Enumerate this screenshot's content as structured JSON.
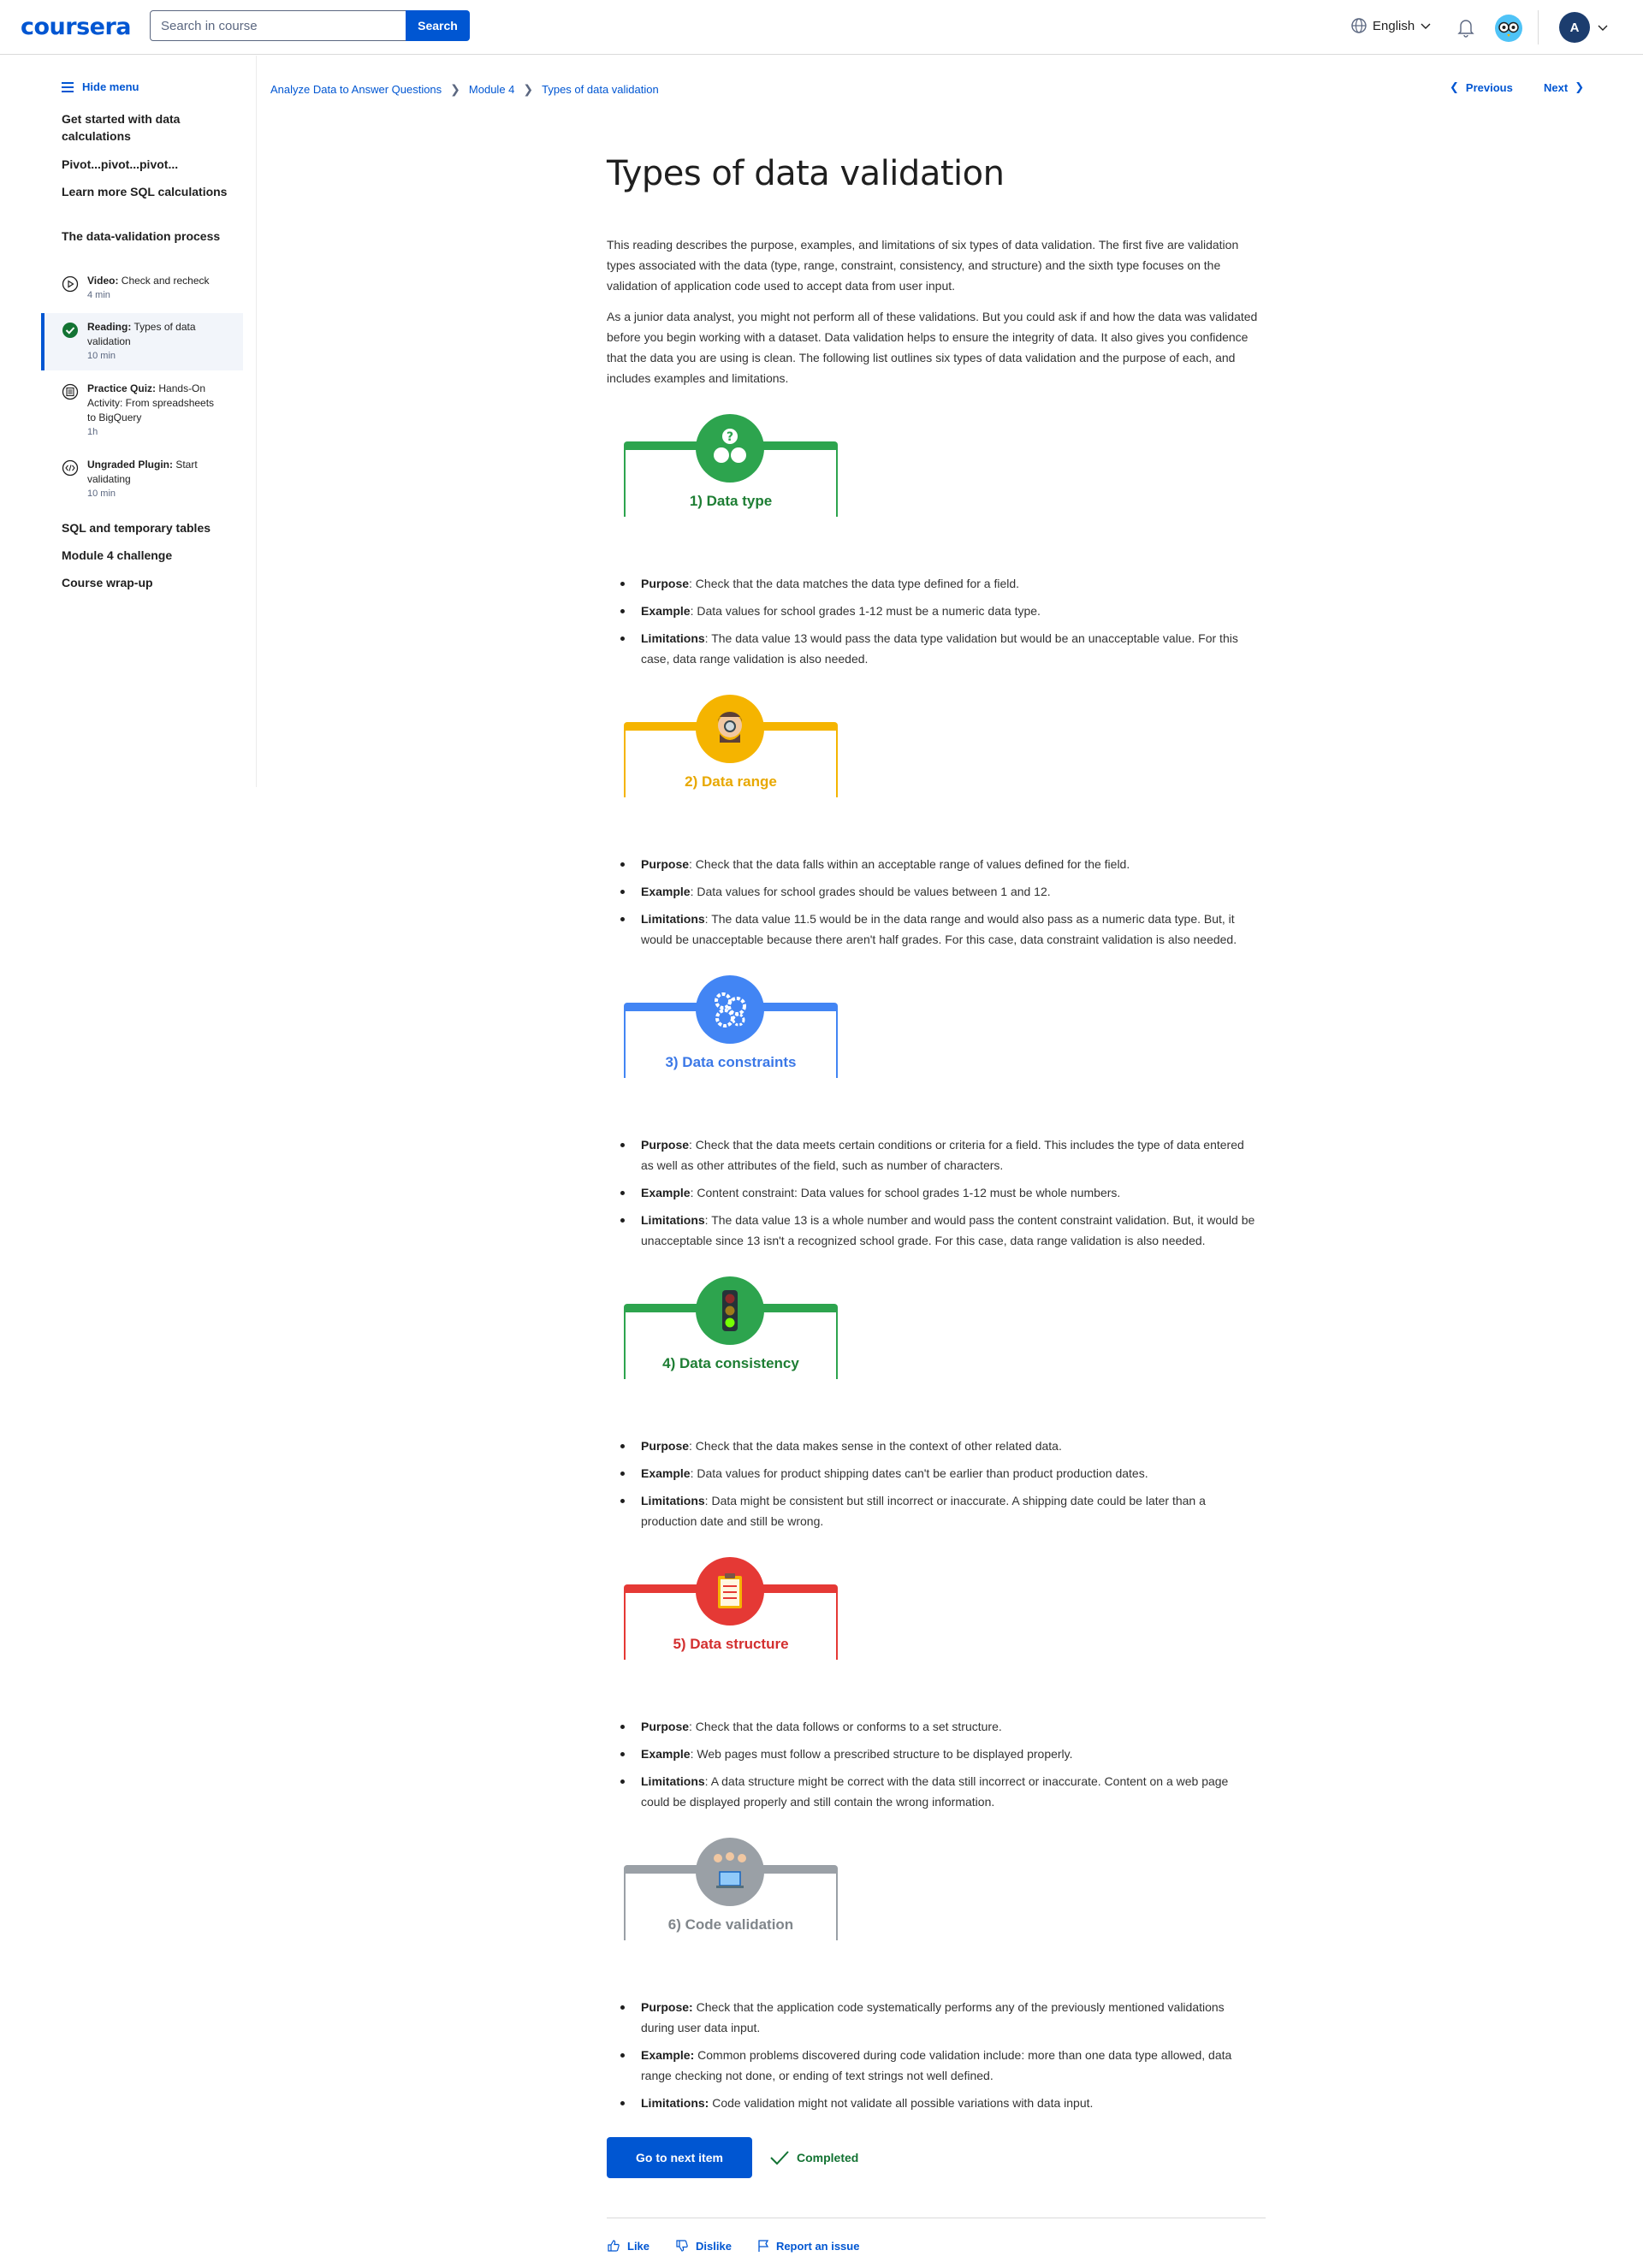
{
  "header": {
    "logo": "coursera",
    "search_placeholder": "Search in course",
    "search_button": "Search",
    "language": "English",
    "avatar_initial": "A"
  },
  "sidebar": {
    "hide_menu": "Hide menu",
    "sections": [
      "Get started with data calculations",
      "Pivot...pivot...pivot...",
      "Learn more SQL calculations",
      "The data-validation process"
    ],
    "items": [
      {
        "type": "Video:",
        "title": "Check and recheck",
        "duration": "4 min"
      },
      {
        "type": "Reading:",
        "title": "Types of data validation",
        "duration": "10 min"
      },
      {
        "type": "Practice Quiz:",
        "title": "Hands-On Activity: From spreadsheets to BigQuery",
        "duration": "1h"
      },
      {
        "type": "Ungraded Plugin:",
        "title": "Start validating",
        "duration": "10 min"
      }
    ],
    "after_sections": [
      "SQL and temporary tables",
      "Module 4 challenge",
      "Course wrap-up"
    ]
  },
  "breadcrumb": [
    "Analyze Data to Answer Questions",
    "Module 4",
    "Types of data validation"
  ],
  "nav": {
    "previous": "Previous",
    "next": "Next"
  },
  "main": {
    "title": "Types of data validation",
    "intro": [
      "This reading describes the purpose, examples, and limitations of six types of data validation. The first five are validation types associated with the data (type, range, constraint, consistency, and structure) and the sixth type focuses on the validation of application code used to accept data from user input.",
      "As a junior data analyst, you might not perform all of these validations. But you could ask if and how the data was validated before you begin working with a dataset. Data validation helps to ensure the integrity of data. It also gives you confidence that the data you are using is clean. The following list outlines six types of data validation and the purpose of each, and includes examples and limitations."
    ],
    "sections": [
      {
        "card_label": "1) Data type",
        "color": "#2da44e",
        "label_color": "#1e7e34",
        "icon": "question-heads-icon",
        "bullets": [
          {
            "key": "Purpose",
            "text": "Check that the data matches the data type defined for a field."
          },
          {
            "key": "Example",
            "text": "Data values for school grades 1-12 must be a numeric data type."
          },
          {
            "key": "Limitations",
            "text": "The data value 13 would pass the data type validation but would be an unacceptable value. For this case, data range validation is also needed."
          }
        ]
      },
      {
        "card_label": "2) Data range",
        "color": "#f5b400",
        "label_color": "#e8a800",
        "icon": "scientist-icon",
        "bullets": [
          {
            "key": "Purpose",
            "text": "Check that the data falls within an acceptable range of values defined for the field."
          },
          {
            "key": "Example",
            "text": "Data values for school grades should be values between 1 and 12."
          },
          {
            "key": "Limitations",
            "text": "The data value 11.5 would be in the data range and would also pass as a numeric data type. But, it would be unacceptable because there aren't half grades. For this case, data constraint validation is also needed."
          }
        ]
      },
      {
        "card_label": "3) Data constraints",
        "color": "#4285f4",
        "label_color": "#3b78e7",
        "icon": "gears-icon",
        "bullets": [
          {
            "key": "Purpose",
            "text": "Check that the data meets certain conditions or criteria for a field. This includes the type of data entered as well as other attributes of the field, such as number of characters."
          },
          {
            "key": "Example",
            "text": "Content constraint: Data values for school grades 1-12 must be whole numbers."
          },
          {
            "key": "Limitations",
            "text": "The data value 13 is a whole number and would pass the content constraint validation. But, it would be unacceptable since 13 isn't a recognized school grade. For this case, data range validation is also needed."
          }
        ]
      },
      {
        "card_label": "4) Data consistency",
        "color": "#2da44e",
        "label_color": "#1e7e34",
        "icon": "traffic-light-icon",
        "bullets": [
          {
            "key": "Purpose",
            "text": "Check that the data makes sense in the context of other related data."
          },
          {
            "key": "Example",
            "text": "Data values for product shipping dates can't be earlier than product production dates."
          },
          {
            "key": "Limitations",
            "text": "Data might be consistent but still incorrect or inaccurate. A shipping date could be later than a production date and still be wrong."
          }
        ]
      },
      {
        "card_label": "5) Data structure",
        "color": "#e53935",
        "label_color": "#d32f2f",
        "icon": "clipboard-icon",
        "bullets": [
          {
            "key": "Purpose",
            "text": "Check that the data follows or conforms to a set structure."
          },
          {
            "key": "Example",
            "text": "Web pages must follow a prescribed structure to be displayed properly."
          },
          {
            "key": "Limitations",
            "text": "A data structure might be correct with the data still incorrect or inaccurate. Content on a web page could be displayed properly and still contain the wrong information."
          }
        ]
      },
      {
        "card_label": "6) Code validation",
        "color": "#9aa0a6",
        "label_color": "#80868b",
        "icon": "laptop-people-icon",
        "bullets": [
          {
            "key": "Purpose:",
            "text": "Check that the application code systematically performs any of the previously mentioned validations during user data input."
          },
          {
            "key": "Example:",
            "text": "Common problems discovered during code validation include: more than one data type allowed, data range checking not done, or ending of text strings not well defined."
          },
          {
            "key": "Limitations:",
            "text": "Code validation might not validate all possible variations with data input."
          }
        ]
      }
    ],
    "next_button": "Go to next item",
    "completed": "Completed",
    "feedback": {
      "like": "Like",
      "dislike": "Dislike",
      "report": "Report an issue"
    }
  }
}
